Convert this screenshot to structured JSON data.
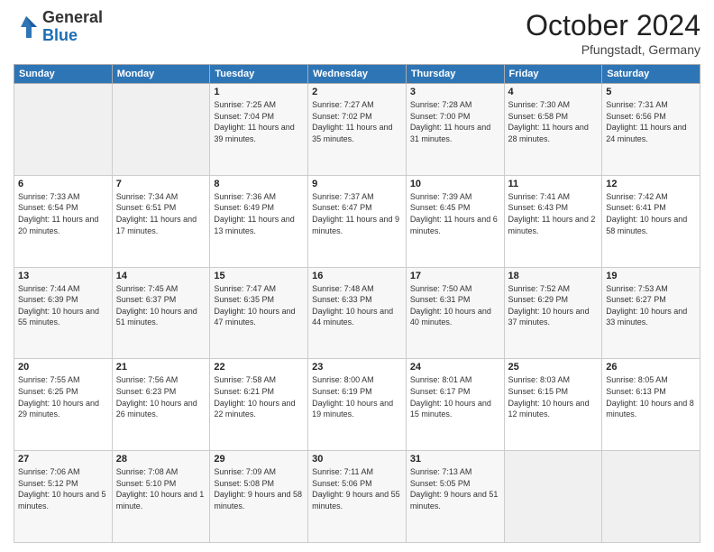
{
  "logo": {
    "general": "General",
    "blue": "Blue"
  },
  "header": {
    "month": "October 2024",
    "location": "Pfungstadt, Germany"
  },
  "weekdays": [
    "Sunday",
    "Monday",
    "Tuesday",
    "Wednesday",
    "Thursday",
    "Friday",
    "Saturday"
  ],
  "weeks": [
    [
      {
        "day": "",
        "info": ""
      },
      {
        "day": "",
        "info": ""
      },
      {
        "day": "1",
        "info": "Sunrise: 7:25 AM\nSunset: 7:04 PM\nDaylight: 11 hours and 39 minutes."
      },
      {
        "day": "2",
        "info": "Sunrise: 7:27 AM\nSunset: 7:02 PM\nDaylight: 11 hours and 35 minutes."
      },
      {
        "day": "3",
        "info": "Sunrise: 7:28 AM\nSunset: 7:00 PM\nDaylight: 11 hours and 31 minutes."
      },
      {
        "day": "4",
        "info": "Sunrise: 7:30 AM\nSunset: 6:58 PM\nDaylight: 11 hours and 28 minutes."
      },
      {
        "day": "5",
        "info": "Sunrise: 7:31 AM\nSunset: 6:56 PM\nDaylight: 11 hours and 24 minutes."
      }
    ],
    [
      {
        "day": "6",
        "info": "Sunrise: 7:33 AM\nSunset: 6:54 PM\nDaylight: 11 hours and 20 minutes."
      },
      {
        "day": "7",
        "info": "Sunrise: 7:34 AM\nSunset: 6:51 PM\nDaylight: 11 hours and 17 minutes."
      },
      {
        "day": "8",
        "info": "Sunrise: 7:36 AM\nSunset: 6:49 PM\nDaylight: 11 hours and 13 minutes."
      },
      {
        "day": "9",
        "info": "Sunrise: 7:37 AM\nSunset: 6:47 PM\nDaylight: 11 hours and 9 minutes."
      },
      {
        "day": "10",
        "info": "Sunrise: 7:39 AM\nSunset: 6:45 PM\nDaylight: 11 hours and 6 minutes."
      },
      {
        "day": "11",
        "info": "Sunrise: 7:41 AM\nSunset: 6:43 PM\nDaylight: 11 hours and 2 minutes."
      },
      {
        "day": "12",
        "info": "Sunrise: 7:42 AM\nSunset: 6:41 PM\nDaylight: 10 hours and 58 minutes."
      }
    ],
    [
      {
        "day": "13",
        "info": "Sunrise: 7:44 AM\nSunset: 6:39 PM\nDaylight: 10 hours and 55 minutes."
      },
      {
        "day": "14",
        "info": "Sunrise: 7:45 AM\nSunset: 6:37 PM\nDaylight: 10 hours and 51 minutes."
      },
      {
        "day": "15",
        "info": "Sunrise: 7:47 AM\nSunset: 6:35 PM\nDaylight: 10 hours and 47 minutes."
      },
      {
        "day": "16",
        "info": "Sunrise: 7:48 AM\nSunset: 6:33 PM\nDaylight: 10 hours and 44 minutes."
      },
      {
        "day": "17",
        "info": "Sunrise: 7:50 AM\nSunset: 6:31 PM\nDaylight: 10 hours and 40 minutes."
      },
      {
        "day": "18",
        "info": "Sunrise: 7:52 AM\nSunset: 6:29 PM\nDaylight: 10 hours and 37 minutes."
      },
      {
        "day": "19",
        "info": "Sunrise: 7:53 AM\nSunset: 6:27 PM\nDaylight: 10 hours and 33 minutes."
      }
    ],
    [
      {
        "day": "20",
        "info": "Sunrise: 7:55 AM\nSunset: 6:25 PM\nDaylight: 10 hours and 29 minutes."
      },
      {
        "day": "21",
        "info": "Sunrise: 7:56 AM\nSunset: 6:23 PM\nDaylight: 10 hours and 26 minutes."
      },
      {
        "day": "22",
        "info": "Sunrise: 7:58 AM\nSunset: 6:21 PM\nDaylight: 10 hours and 22 minutes."
      },
      {
        "day": "23",
        "info": "Sunrise: 8:00 AM\nSunset: 6:19 PM\nDaylight: 10 hours and 19 minutes."
      },
      {
        "day": "24",
        "info": "Sunrise: 8:01 AM\nSunset: 6:17 PM\nDaylight: 10 hours and 15 minutes."
      },
      {
        "day": "25",
        "info": "Sunrise: 8:03 AM\nSunset: 6:15 PM\nDaylight: 10 hours and 12 minutes."
      },
      {
        "day": "26",
        "info": "Sunrise: 8:05 AM\nSunset: 6:13 PM\nDaylight: 10 hours and 8 minutes."
      }
    ],
    [
      {
        "day": "27",
        "info": "Sunrise: 7:06 AM\nSunset: 5:12 PM\nDaylight: 10 hours and 5 minutes."
      },
      {
        "day": "28",
        "info": "Sunrise: 7:08 AM\nSunset: 5:10 PM\nDaylight: 10 hours and 1 minute."
      },
      {
        "day": "29",
        "info": "Sunrise: 7:09 AM\nSunset: 5:08 PM\nDaylight: 9 hours and 58 minutes."
      },
      {
        "day": "30",
        "info": "Sunrise: 7:11 AM\nSunset: 5:06 PM\nDaylight: 9 hours and 55 minutes."
      },
      {
        "day": "31",
        "info": "Sunrise: 7:13 AM\nSunset: 5:05 PM\nDaylight: 9 hours and 51 minutes."
      },
      {
        "day": "",
        "info": ""
      },
      {
        "day": "",
        "info": ""
      }
    ]
  ]
}
